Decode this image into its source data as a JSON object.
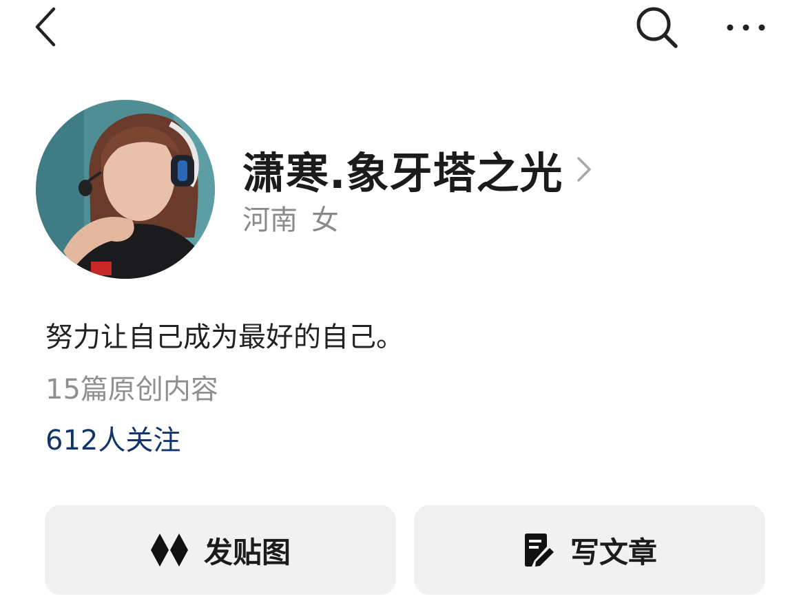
{
  "topbar": {
    "back_icon": "chevron-left-icon",
    "search_icon": "search-icon",
    "more_icon": "more-horizontal-icon"
  },
  "profile": {
    "name": "潇寒.象牙塔之光",
    "region": "河南",
    "gender": "女",
    "bio": "努力让自己成为最好的自己。",
    "original_count_text": "15篇原创内容",
    "followers_text": "612人关注"
  },
  "actions": {
    "post_label": "发贴图",
    "post_icon": "diamonds-logo-icon",
    "article_label": "写文章",
    "article_icon": "note-edit-icon"
  },
  "colors": {
    "name": "#1b1b1b",
    "secondary": "#8a8a8a",
    "followers": "#12356b",
    "button_bg": "#f1f1f1"
  }
}
